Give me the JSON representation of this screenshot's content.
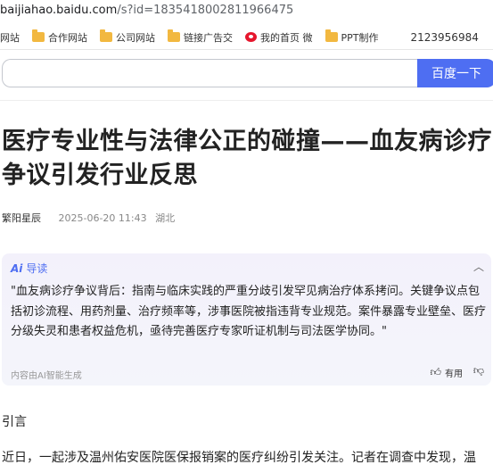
{
  "browser": {
    "url_host": "baijiahao.baidu.com",
    "url_rest": "/s?id=1835418002811966475"
  },
  "bookmarks": {
    "items": [
      {
        "label": "网站",
        "icon": "folder-icon"
      },
      {
        "label": "合作网站",
        "icon": "folder-icon"
      },
      {
        "label": "公司网站",
        "icon": "folder-icon"
      },
      {
        "label": "链接广告交",
        "icon": "folder-icon"
      },
      {
        "label": "我的首页 微",
        "icon": "weibo-icon"
      },
      {
        "label": "PPT制作",
        "icon": "folder-icon"
      }
    ],
    "phone": "2123956984"
  },
  "search": {
    "button_label": "百度一下",
    "accent_color": "#4e6ef2"
  },
  "article": {
    "title": "医疗专业性与法律公正的碰撞——血友病诊疗争议引发行业反思",
    "author": "繁阳星辰",
    "date": "2025-06-20 11:43",
    "location": "湖北",
    "ai_summary": {
      "logo": "Ai",
      "label": "导读",
      "text": "\"血友病诊疗争议背后：指南与临床实践的严重分歧引发罕见病治疗体系拷问。关键争议点包括初诊流程、用药剂量、治疗频率等，涉事医院被指违背专业规范。案件暴露专业壁垒、医疗分级失灵和患者权益危机，亟待完善医疗专家听证机制与司法医学协同。\"",
      "footer": "内容由AI智能生成",
      "useful_label": "有用"
    },
    "section_heading": "引言",
    "first_para": "近日，一起涉及温州佑安医院医保报销案的医疗纠纷引发关注。记者在调查中发现，温"
  }
}
